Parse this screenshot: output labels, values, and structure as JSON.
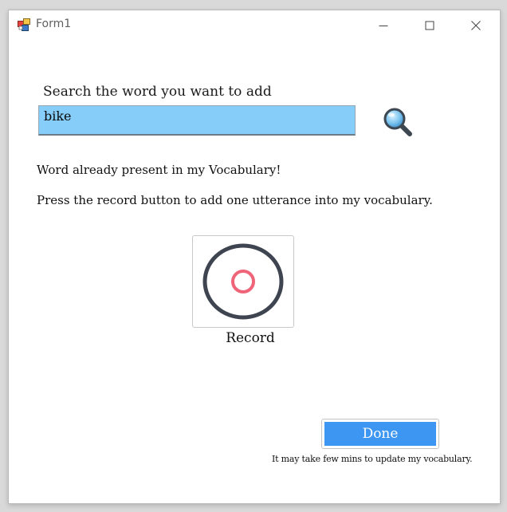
{
  "window": {
    "title": "Form1"
  },
  "search": {
    "label": "Search the word you want to add",
    "value": "bike",
    "icon": "magnifier-icon"
  },
  "messages": {
    "status": "Word already present in my Vocabulary!",
    "instruction": "Press the record button to add one utterance into my vocabulary."
  },
  "record": {
    "label": "Record",
    "icon": "record-icon"
  },
  "done": {
    "label": "Done",
    "note": "It may take few mins to update my vocabulary."
  },
  "colors": {
    "input_bg": "#87cdfa",
    "done_bg": "#3d97f2",
    "record_ring": "#3f4550",
    "record_dot": "#f0647a"
  }
}
